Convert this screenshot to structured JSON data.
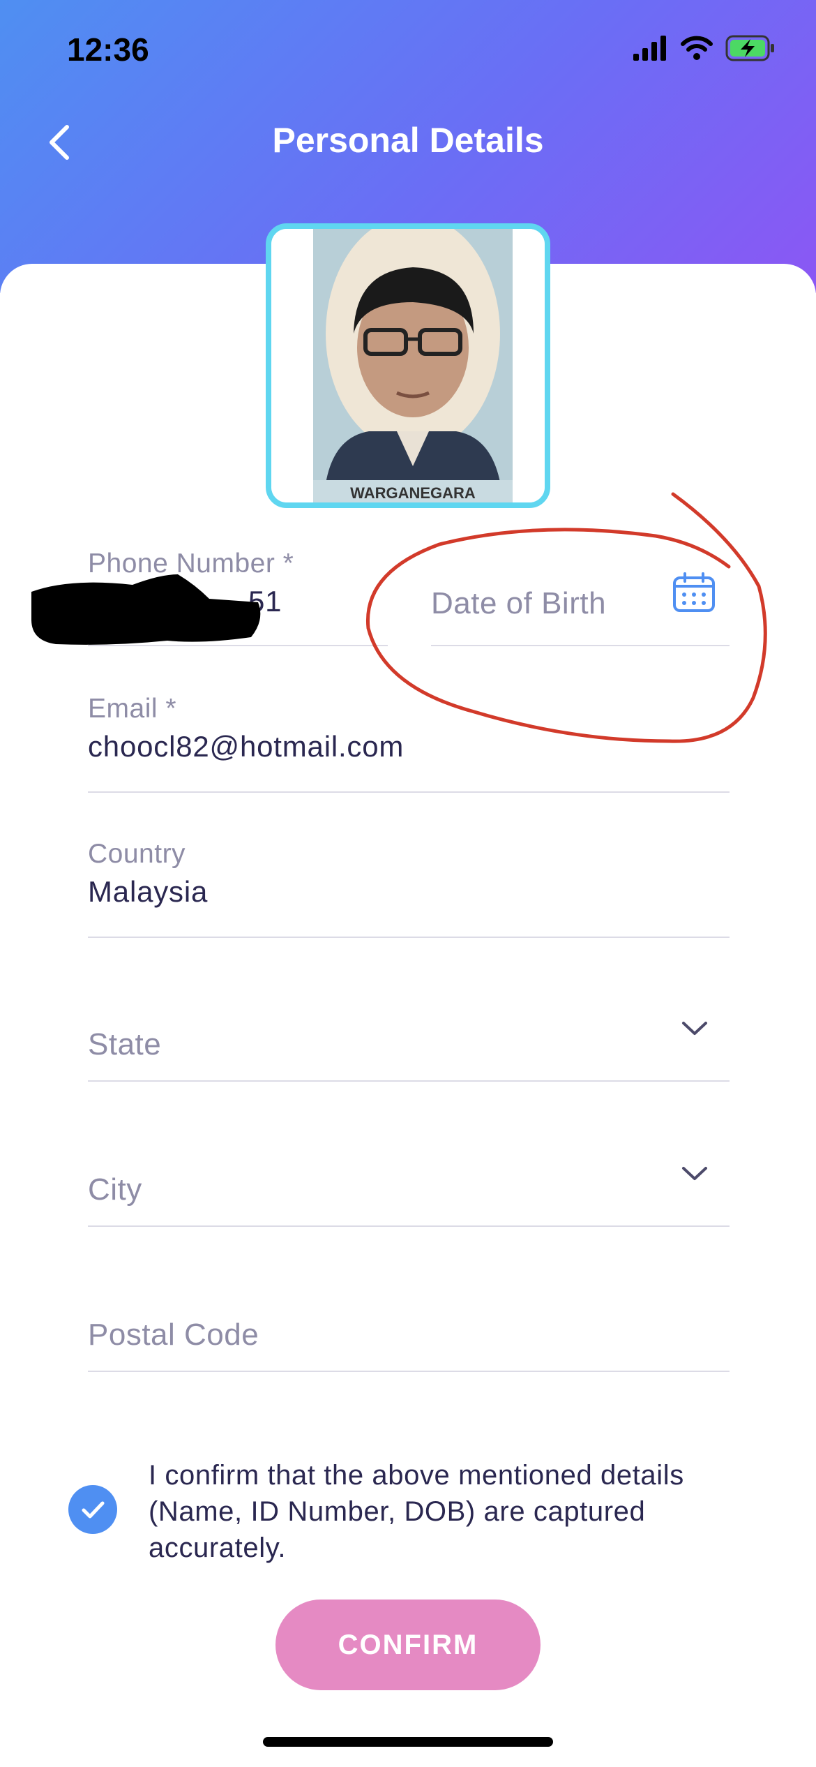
{
  "status_bar": {
    "time": "12:36"
  },
  "header": {
    "title": "Personal Details"
  },
  "photo": {
    "card_text": "WARGANEGARA"
  },
  "form": {
    "phone": {
      "label": "Phone Number *",
      "value_visible": "51"
    },
    "dob": {
      "placeholder": "Date of Birth"
    },
    "email": {
      "label": "Email *",
      "value": "choocl82@hotmail.com"
    },
    "country": {
      "label": "Country",
      "value": "Malaysia"
    },
    "state": {
      "placeholder": "State"
    },
    "city": {
      "placeholder": "City"
    },
    "postal": {
      "placeholder": "Postal Code"
    }
  },
  "confirm": {
    "checked": true,
    "text": "I confirm that the above mentioned details (Name, ID Number, DOB) are captured accurately.",
    "button_label": "CONFIRM"
  },
  "colors": {
    "header_gradient": [
      "#4f8ff2",
      "#6a6ef5",
      "#8b57f4"
    ],
    "accent_blue": "#4f8ff2",
    "photo_border": "#5fd6f0",
    "button_pink": "#e58ac3",
    "annotation_red": "#d23a2a"
  },
  "icons": [
    "chevron-left-icon",
    "calendar-icon",
    "chevron-down-icon",
    "checkmark-icon",
    "signal-icon",
    "wifi-icon",
    "battery-icon"
  ]
}
